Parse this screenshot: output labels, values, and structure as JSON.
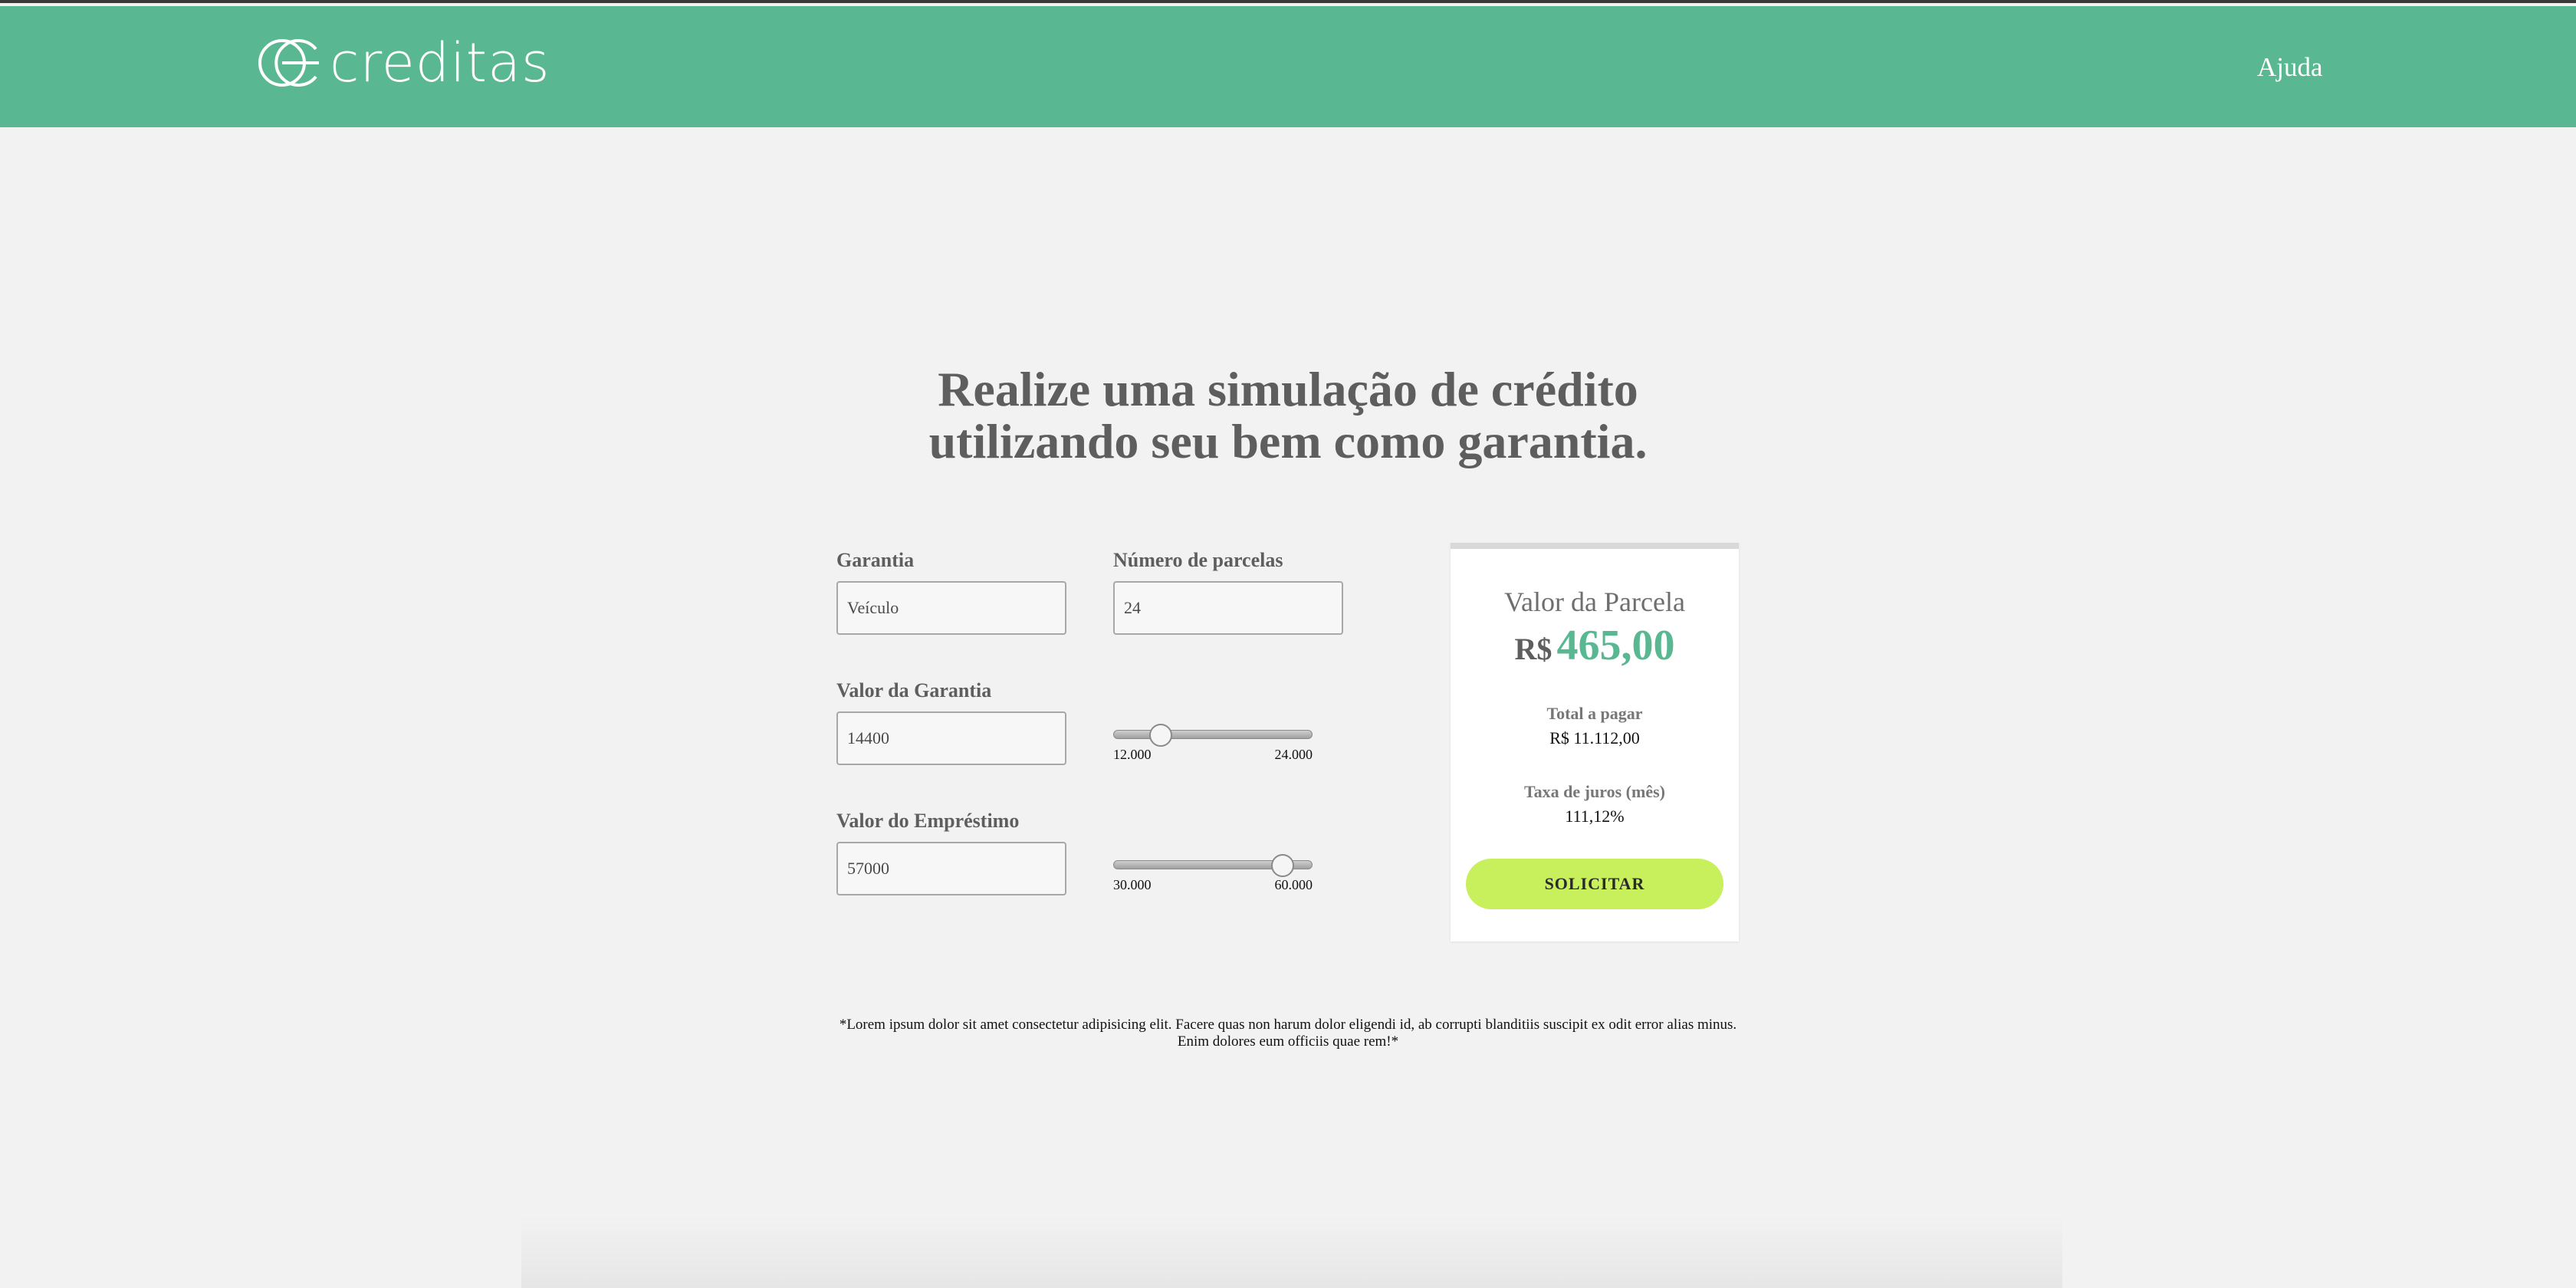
{
  "brand": {
    "name": "creditas",
    "color": "#59b891"
  },
  "nav": {
    "help_label": "Ajuda"
  },
  "headline": {
    "line1": "Realize uma simulação de crédito",
    "line2": "utilizando seu bem como garantia."
  },
  "form": {
    "collateral_label": "Garantia",
    "collateral_value": "Veículo",
    "installments_label": "Número de parcelas",
    "installments_value": "24",
    "collateral_amount_label": "Valor da Garantia",
    "collateral_amount_value": "14400",
    "collateral_slider": {
      "min_label": "12.000",
      "max_label": "24.000",
      "fraction": 0.24
    },
    "loan_amount_label": "Valor do Empréstimo",
    "loan_amount_value": "57000",
    "loan_slider": {
      "min_label": "30.000",
      "max_label": "60.000",
      "fraction": 0.85
    }
  },
  "result": {
    "title": "Valor da Parcela",
    "currency": "R$",
    "installment_value": "465,00",
    "total_label": "Total a pagar",
    "total_value": "R$ 11.112,00",
    "rate_label": "Taxa de juros (mês)",
    "rate_value": "111,12%",
    "button_label": "SOLICITAR",
    "button_color": "#c8ef5c"
  },
  "disclaimer": {
    "line1": "*Lorem ipsum dolor sit amet consectetur adipisicing elit. Facere quas non harum dolor eligendi id, ab corrupti blanditiis suscipit ex odit error alias minus.",
    "line2": "Enim dolores eum officiis quae rem!*"
  }
}
